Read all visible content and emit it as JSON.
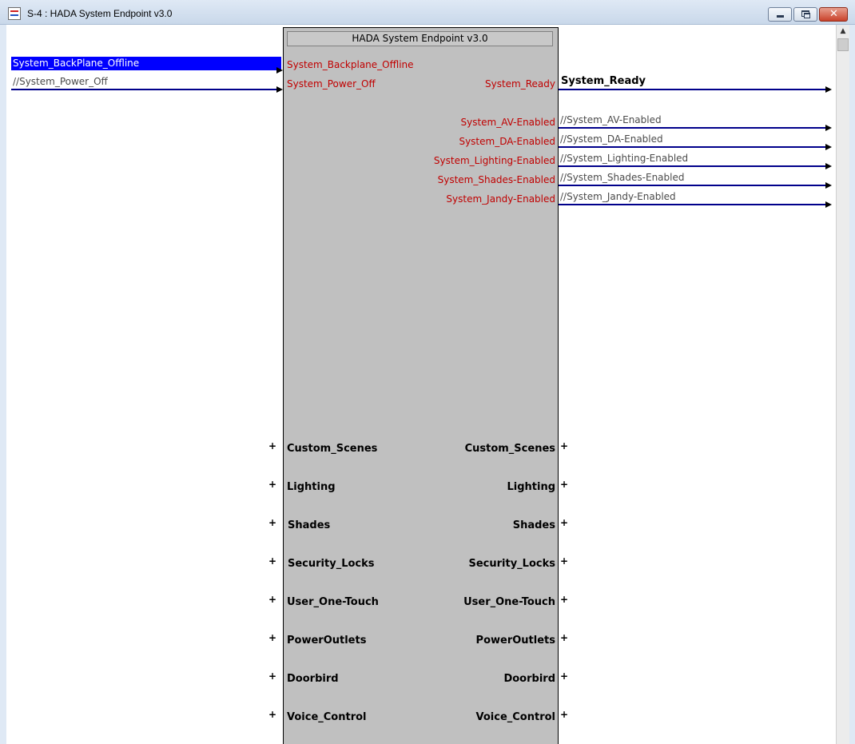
{
  "window": {
    "title": "S-4 : HADA System Endpoint v3.0",
    "close_glyph": "✕"
  },
  "module": {
    "title": "HADA System Endpoint v3.0",
    "left_inputs": [
      "System_Backplane_Offline",
      "System_Power_Off"
    ],
    "right_outputs": [
      "System_Ready",
      "System_AV-Enabled",
      "System_DA-Enabled",
      "System_Lighting-Enabled",
      "System_Shades-Enabled",
      "System_Jandy-Enabled"
    ],
    "groups": [
      "Custom_Scenes",
      "Lighting",
      "Shades",
      "Security_Locks",
      "User_One-Touch",
      "PowerOutlets",
      "Doorbird",
      "Voice_Control"
    ]
  },
  "signals_in": {
    "selected": "System_BackPlane_Offline",
    "power_off": "//System_Power_Off"
  },
  "signals_out": [
    "System_Ready",
    "//System_AV-Enabled",
    "//System_DA-Enabled",
    "//System_Lighting-Enabled",
    "//System_Shades-Enabled",
    "//System_Jandy-Enabled"
  ],
  "expand_glyph": "+",
  "scroll_up_glyph": "▲",
  "colors": {
    "selection": "#0000ff",
    "wire": "#00008b",
    "port_label": "#c00000",
    "module_bg": "#c0c0c0"
  }
}
